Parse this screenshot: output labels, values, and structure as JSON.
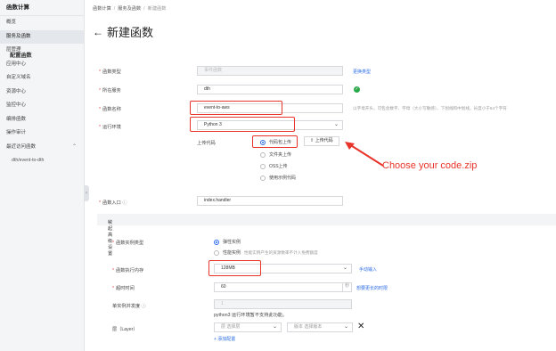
{
  "sidebar": {
    "title": "函数计算",
    "items": [
      {
        "label": "概览"
      },
      {
        "label": "服务及函数"
      },
      {
        "label": "层管理"
      },
      {
        "label": "应用中心"
      },
      {
        "label": "自定义域名"
      },
      {
        "label": "资源中心"
      },
      {
        "label": "监控中心"
      },
      {
        "label": "编排函数"
      },
      {
        "label": "操作审计"
      },
      {
        "label": "最近访问函数"
      }
    ],
    "recent": [
      {
        "label": "dth/event-to-dth"
      }
    ]
  },
  "breadcrumb": {
    "items": [
      "函数计算",
      "服务及函数",
      "新建函数"
    ]
  },
  "page": {
    "back": "←",
    "title": "新建函数"
  },
  "section": {
    "title": "配置函数"
  },
  "form": {
    "func_type": {
      "label": "函数类型",
      "value": "事件函数",
      "link": "更换类型"
    },
    "service": {
      "label": "所在服务",
      "value": "dth"
    },
    "func_name": {
      "label": "函数名称",
      "value": "event-to-aws",
      "hint": "以字母开头，可包含数字、字母（大小写敏感）、下划线和中划线，长度小于64个字符"
    },
    "runtime": {
      "label": "运行环境",
      "value": "Python 3"
    },
    "upload": {
      "label": "上传代码",
      "button_label": "上传代码",
      "options": [
        "代码包上传",
        "文件夹上传",
        "OSS上传",
        "使用示例代码"
      ]
    },
    "handler": {
      "label": "函数入口",
      "value": "index.handler"
    },
    "advanced": {
      "label": "收起高级设置"
    },
    "instance_type": {
      "label": "函数实例类型",
      "options": [
        "弹性实例",
        "性能实例"
      ],
      "perf_hint": "性能实例产生的资源数率不计入免费额度"
    },
    "memory": {
      "label": "函数执行内存",
      "value": "128MB",
      "link": "手动输入"
    },
    "timeout": {
      "label": "超时时间",
      "value": "60",
      "unit": "秒",
      "link": "想要更长的时限"
    },
    "concurrency": {
      "label": "单实例并发度",
      "value": "1",
      "note": "python3 运行环境暂不支持此功能。"
    },
    "layer": {
      "label": "层（Layer）",
      "layer_placeholder": "选择层",
      "version_label": "版本",
      "version_placeholder": "选择版本",
      "add_link": "+ 添加配置"
    }
  },
  "annotation": {
    "text": "Choose your code.zip"
  },
  "colors": {
    "accent": "#2b6de5",
    "highlight": "#e8342a",
    "success": "#2ba84a"
  }
}
